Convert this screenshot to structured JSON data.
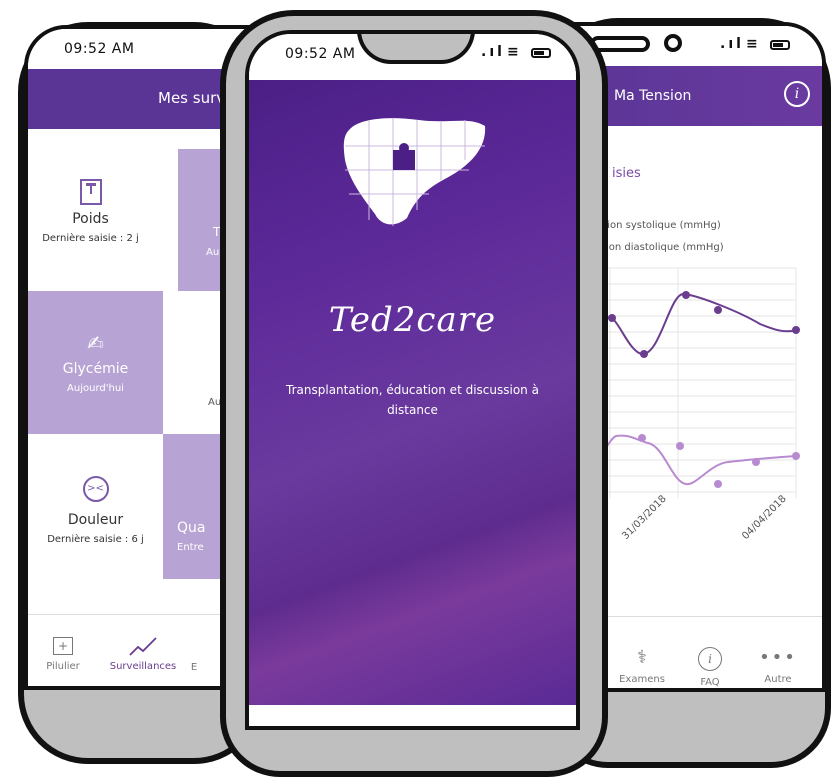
{
  "left_phone": {
    "status_time": "09:52 AM",
    "header_title": "Mes surv",
    "cells": [
      {
        "name": "Poids",
        "sub": "Dernière saisie : 2 j",
        "icon": "scale-icon"
      },
      {
        "name": "Glycémie",
        "sub": "Aujourd'hui",
        "icon": "glucose-icon"
      },
      {
        "name": "Douleur",
        "sub": "Dernière saisie : 6 j",
        "icon": "sad-face-icon"
      }
    ],
    "partial_cells": [
      "T",
      "Au",
      "Au",
      "Qua",
      "Entre"
    ],
    "tabs": [
      {
        "label": "Pilulier",
        "icon": "pill-box-icon"
      },
      {
        "label": "Surveillances",
        "icon": "trend-icon"
      },
      {
        "label": "E",
        "icon": ""
      }
    ]
  },
  "center_phone": {
    "status_time": "09:52 AM",
    "app_name": "Ted2care",
    "tagline": "Transplantation, éducation et discussion à distance",
    "logo": "liver-puzzle-icon"
  },
  "right_phone": {
    "header_title": "Ma Tension",
    "section_label": "isies",
    "legend": [
      "sion systolique (mmHg)",
      "ion diastolique (mmHg)"
    ],
    "tabs": [
      {
        "label": "Examens",
        "icon": "stethoscope-icon"
      },
      {
        "label": "FAQ",
        "icon": "info-icon"
      },
      {
        "label": "Autre",
        "icon": "more-icon"
      }
    ],
    "colors": {
      "systolic": "#6a3d8f",
      "diastolic": "#b88bd0",
      "header": "#5a3596"
    }
  },
  "chart_data": {
    "type": "line",
    "x": [
      "31/03/2018",
      "04/04/2018"
    ],
    "series": [
      {
        "name": "sion systolique (mmHg)"
      },
      {
        "name": "ion diastolique (mmHg)"
      }
    ]
  }
}
